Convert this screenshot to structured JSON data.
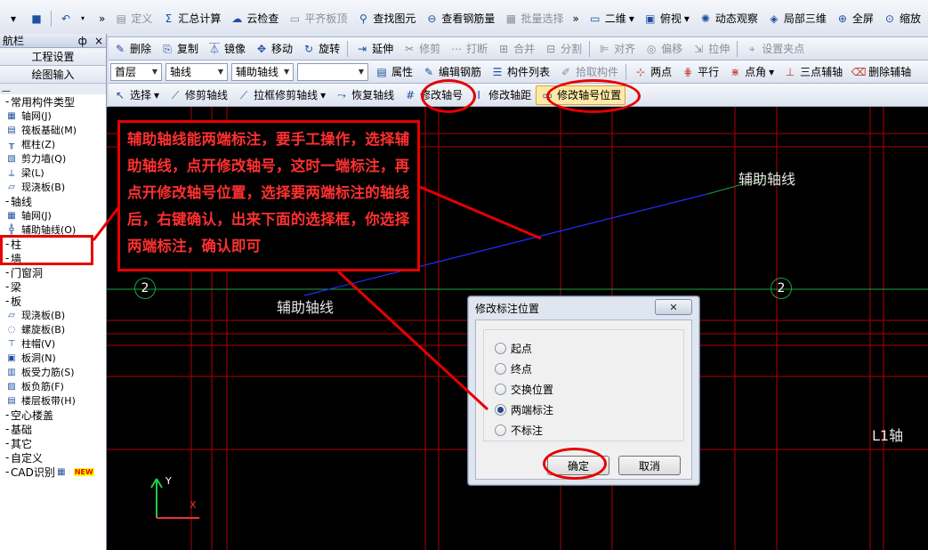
{
  "toolbar1": {
    "items": [
      {
        "label": "定义",
        "icon": "define-icon",
        "disabled": true
      },
      {
        "label": "汇总计算",
        "icon": "sigma-icon"
      },
      {
        "label": "云检查",
        "icon": "cloud-check-icon"
      },
      {
        "label": "平齐板顶",
        "icon": "slab-top-icon",
        "disabled": true
      },
      {
        "label": "查找图元",
        "icon": "binoculars-icon"
      },
      {
        "label": "查看钢筋量",
        "icon": "glasses-icon"
      },
      {
        "label": "批量选择",
        "icon": "batch-select-icon",
        "disabled": true
      },
      {
        "label": "二维",
        "icon": "2d-icon",
        "dropdown": true
      },
      {
        "label": "俯视",
        "icon": "top-view-icon",
        "dropdown": true
      },
      {
        "label": "动态观察",
        "icon": "orbit-icon"
      },
      {
        "label": "局部三维",
        "icon": "local-3d-icon"
      },
      {
        "label": "全屏",
        "icon": "fullscreen-icon"
      },
      {
        "label": "缩放",
        "icon": "zoom-icon"
      }
    ]
  },
  "nav_panel": {
    "title": "航栏",
    "pin": "ф",
    "close": "×",
    "buttons": [
      "工程设置",
      "绘图输入"
    ],
    "tree": [
      {
        "label": "常用构件类型",
        "kind": "group"
      },
      {
        "label": "轴网(J)",
        "kind": "child",
        "icon": "grid-icon"
      },
      {
        "label": "筏板基础(M)",
        "kind": "child",
        "icon": "raft-icon"
      },
      {
        "label": "框柱(Z)",
        "kind": "child",
        "icon": "column-icon"
      },
      {
        "label": "剪力墙(Q)",
        "kind": "child",
        "icon": "shear-wall-icon"
      },
      {
        "label": "梁(L)",
        "kind": "child",
        "icon": "beam-icon"
      },
      {
        "label": "现浇板(B)",
        "kind": "child",
        "icon": "slab-icon"
      },
      {
        "label": "轴线",
        "kind": "group"
      },
      {
        "label": "轴网(J)",
        "kind": "child",
        "icon": "grid-icon"
      },
      {
        "label": "辅助轴线(O)",
        "kind": "child",
        "icon": "aux-axis-icon"
      },
      {
        "label": "柱",
        "kind": "group"
      },
      {
        "label": "墙",
        "kind": "group"
      },
      {
        "label": "门窗洞",
        "kind": "group"
      },
      {
        "label": "梁",
        "kind": "group"
      },
      {
        "label": "板",
        "kind": "group"
      },
      {
        "label": "现浇板(B)",
        "kind": "child",
        "icon": "slab-icon"
      },
      {
        "label": "螺旋板(B)",
        "kind": "child",
        "icon": "spiral-slab-icon"
      },
      {
        "label": "柱帽(V)",
        "kind": "child",
        "icon": "column-cap-icon"
      },
      {
        "label": "板洞(N)",
        "kind": "child",
        "icon": "slab-hole-icon"
      },
      {
        "label": "板受力筋(S)",
        "kind": "child",
        "icon": "rebar-icon"
      },
      {
        "label": "板负筋(F)",
        "kind": "child",
        "icon": "neg-rebar-icon"
      },
      {
        "label": "楼层板带(H)",
        "kind": "child",
        "icon": "slab-band-icon"
      },
      {
        "label": "空心楼盖",
        "kind": "group"
      },
      {
        "label": "基础",
        "kind": "group"
      },
      {
        "label": "其它",
        "kind": "group"
      },
      {
        "label": "自定义",
        "kind": "group"
      },
      {
        "label": "CAD识别",
        "kind": "group",
        "badge": "NEW"
      }
    ]
  },
  "toolbar2": {
    "items": [
      "删除",
      "复制",
      "镜像",
      "移动",
      "旋转",
      "延伸",
      "修剪",
      "打断",
      "合并",
      "分割",
      "对齐",
      "偏移",
      "拉伸",
      "设置夹点"
    ]
  },
  "toolbar3": {
    "floor": "首层",
    "category": "轴线",
    "type": "辅助轴线",
    "element": "",
    "items": [
      "属性",
      "编辑钢筋",
      "构件列表",
      "拾取构件",
      "两点",
      "平行",
      "点角",
      "三点辅轴",
      "删除辅轴"
    ]
  },
  "toolbar4": {
    "items": [
      "选择",
      "修剪轴线",
      "拉框修剪轴线",
      "恢复轴线",
      "修改轴号",
      "修改轴距",
      "修改轴号位置"
    ]
  },
  "canvas": {
    "annotation": "辅助轴线能两端标注，要手工操作，选择辅助轴线，点开修改轴号，这时一端标注，再点开修改轴号位置，选择要两端标注的轴线后，右键确认，出来下面的选择框，你选择两端标注，确认即可",
    "axis_left": "2",
    "axis_right": "2",
    "aux_label_top": "辅助轴线",
    "aux_label_bottom": "辅助轴线",
    "l1_label": "L1轴",
    "ucs_y": "Y",
    "ucs_x": "X"
  },
  "dialog": {
    "title": "修改标注位置",
    "close": "✕",
    "options": [
      {
        "label": "起点",
        "checked": false
      },
      {
        "label": "终点",
        "checked": false
      },
      {
        "label": "交换位置",
        "checked": false
      },
      {
        "label": "两端标注",
        "checked": true
      },
      {
        "label": "不标注",
        "checked": false
      }
    ],
    "ok": "确定",
    "cancel": "取消"
  }
}
